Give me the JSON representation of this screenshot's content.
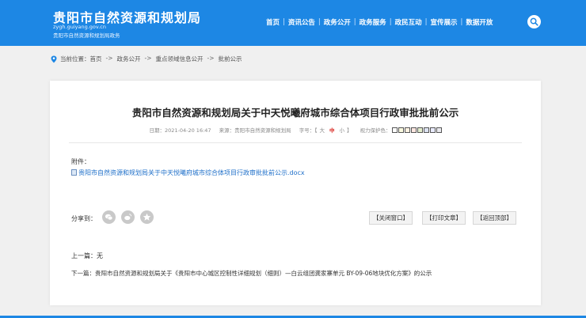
{
  "header": {
    "title": "贵阳市自然资源和规划局",
    "domain": "zygh.guiyang.gov.cn",
    "subtitle": "贵阳市自然资源和规划局政务",
    "nav": [
      "首页",
      "资讯公告",
      "政务公开",
      "政务服务",
      "政民互动",
      "宣传展示",
      "数据开放"
    ],
    "nav_separator": "|"
  },
  "breadcrumb": {
    "prefix": "当前位置：",
    "items": [
      "首页",
      "政务公开",
      "重点领域信息公开",
      "批前公示"
    ],
    "separator": "->"
  },
  "article": {
    "title": "贵阳市自然资源和规划局关于中天悦曦府城市综合体项目行政审批批前公示",
    "date": "日期：2021-04-20 16:47",
    "source": "来源：贵阳市自然资源和规划局",
    "font_size_label": "字号：",
    "font_size_open": "【",
    "font_size_large": "大",
    "font_size_medium": "中",
    "font_size_small": "小",
    "font_size_close": "】",
    "eye_protect_label": "视力保护色：",
    "eye_colors": [
      "#ffffff",
      "#faf9de",
      "#fff2e2",
      "#fde6e0",
      "#e3edcd",
      "#dce2f1",
      "#e9ebfe",
      "#eaeaef"
    ]
  },
  "attachment": {
    "label": "附件：",
    "file": "贵阳市自然资源和规划局关于中天悦曦府城市综合体项目行政审批批前公示.docx"
  },
  "share": {
    "label": "分享到：",
    "icons": [
      "wechat-icon",
      "weibo-icon",
      "qzone-icon"
    ]
  },
  "actions": {
    "close": "【关闭窗口】",
    "print": "【打印文章】",
    "top": "【返回顶部】"
  },
  "pager": {
    "prev": "上一篇：无",
    "next": "下一篇：贵阳市自然资源和规划局关于《贵阳市中心城区控制性详细规划（细则）—白云组团龚家寨单元 BY-09-06地块优化方案》的公示"
  },
  "colors": {
    "brand": "#1d87e4",
    "link": "#1e6fc9",
    "highlight": "#d8201a"
  }
}
